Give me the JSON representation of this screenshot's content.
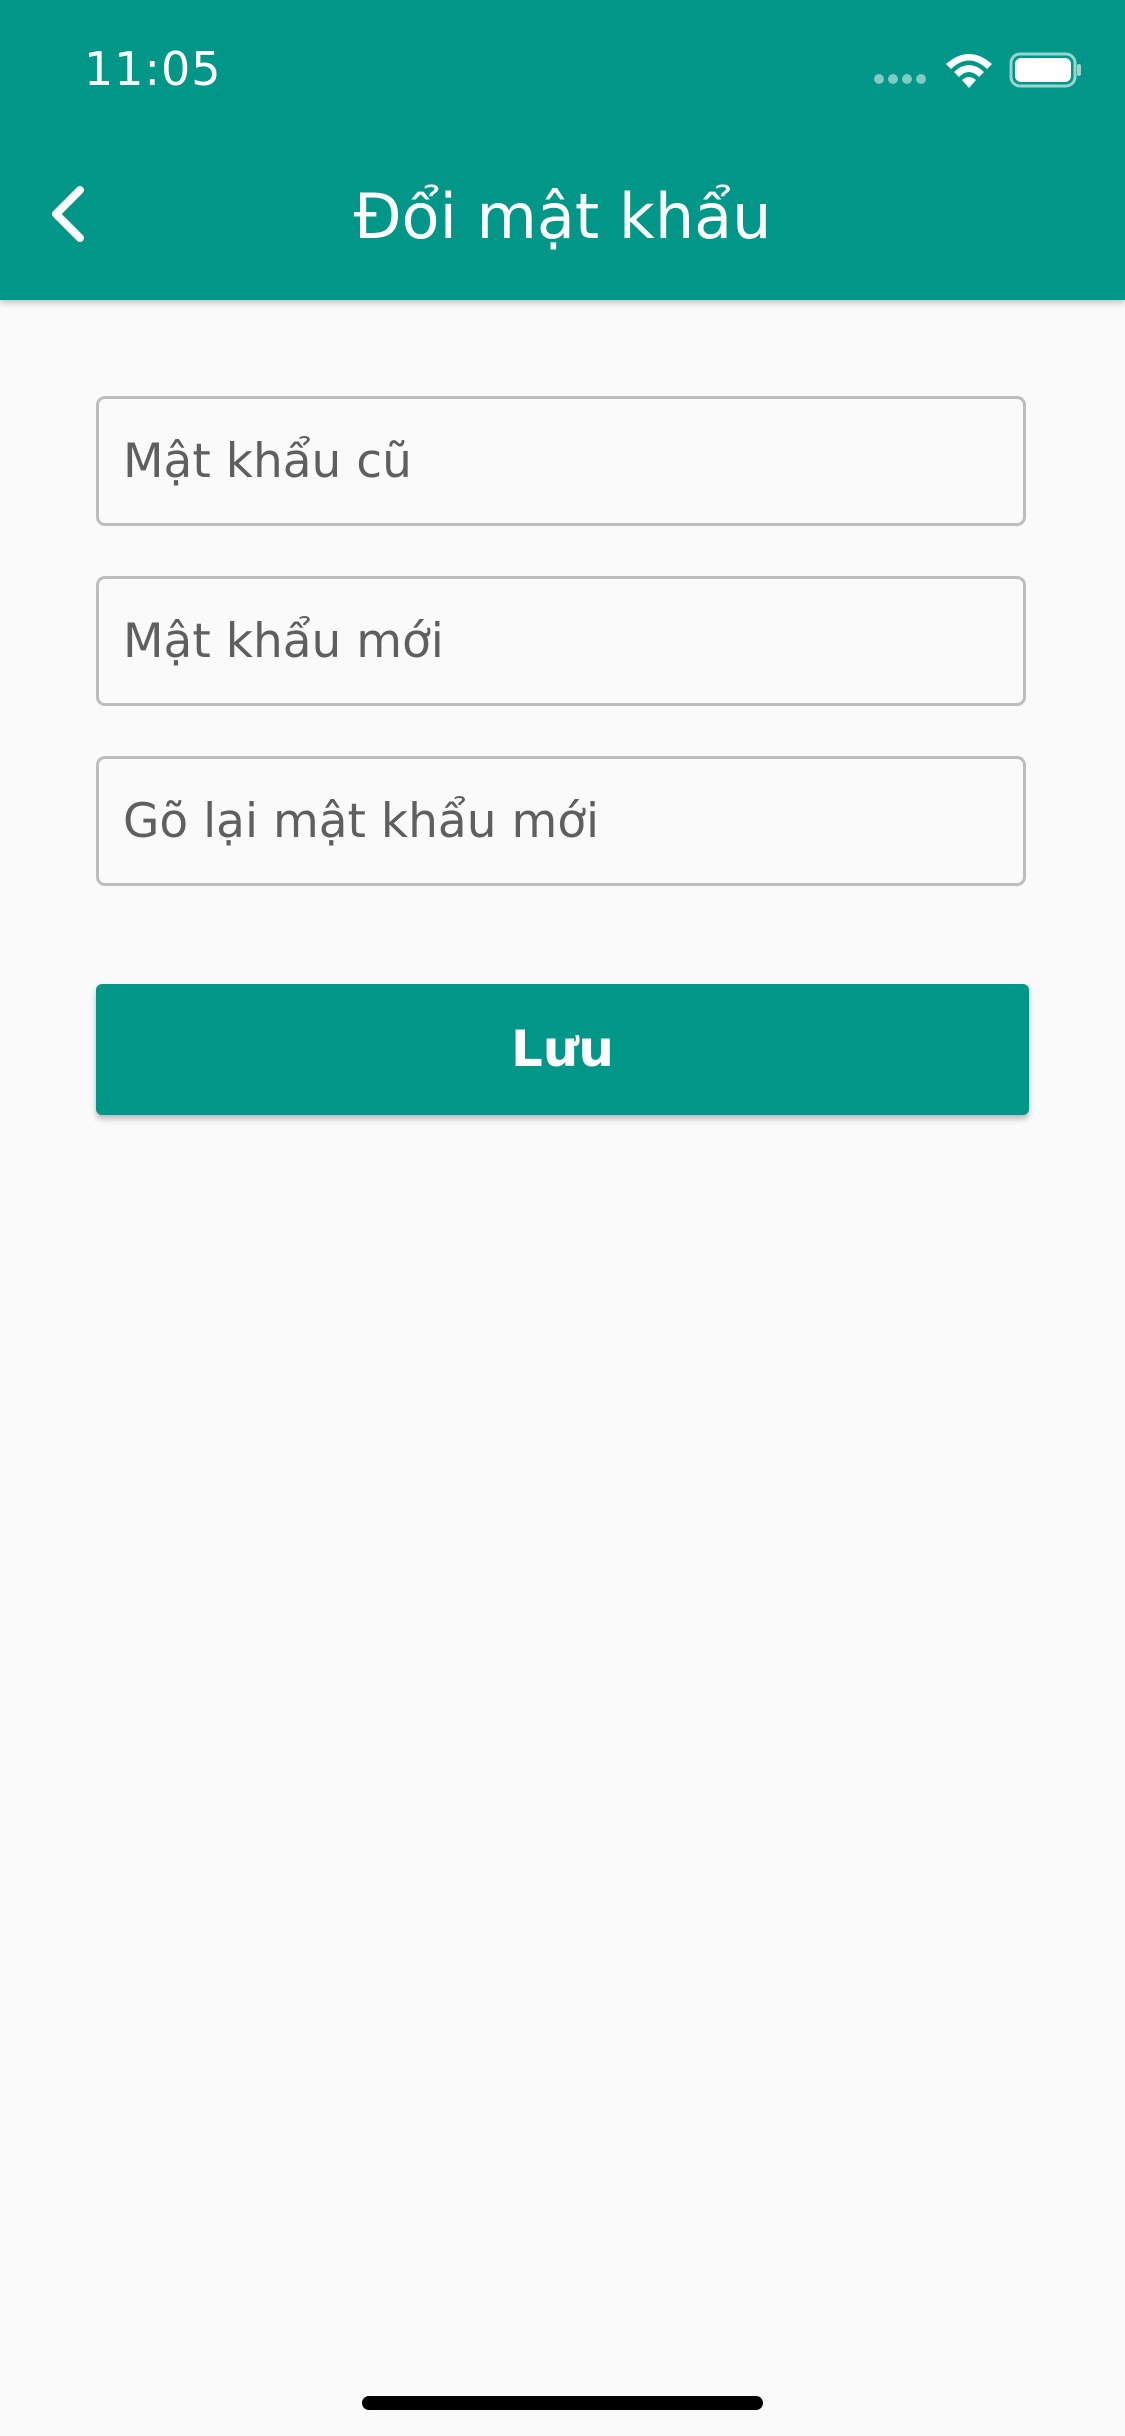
{
  "status_bar": {
    "time": "11:05"
  },
  "app_bar": {
    "title": "Đổi mật khẩu",
    "back_icon": "chevron-left-icon",
    "color": "#009688"
  },
  "form": {
    "old_password": {
      "placeholder": "Mật khẩu cũ",
      "value": ""
    },
    "new_password": {
      "placeholder": "Mật khẩu mới",
      "value": ""
    },
    "confirm_password": {
      "placeholder": "Gõ lại mật khẩu mới",
      "value": ""
    },
    "save_label": "Lưu"
  },
  "colors": {
    "accent": "#009688",
    "background": "#fafafa",
    "border": "#bdbdbd"
  }
}
